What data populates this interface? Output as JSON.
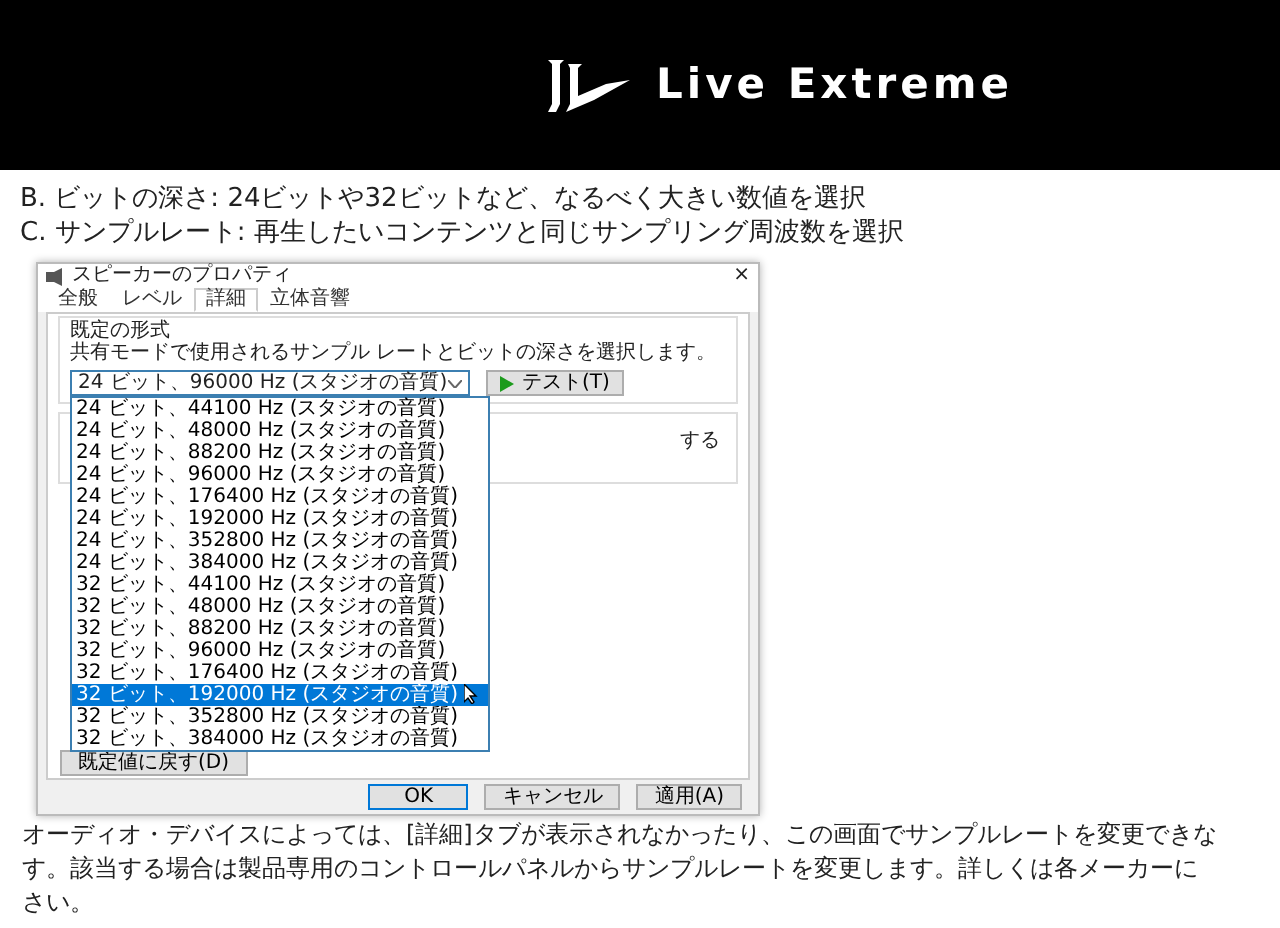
{
  "header": {
    "brand": "Live Extreme"
  },
  "intro_lines": [
    "B. ビットの深さ: 24ビットや32ビットなど、なるべく大きい数値を選択",
    "C. サンプルレート: 再生したいコンテンツと同じサンプリング周波数を選択"
  ],
  "dialog": {
    "title": "スピーカーのプロパティ",
    "close": "×",
    "tabs": [
      {
        "label": "全般",
        "selected": false
      },
      {
        "label": "レベル",
        "selected": false
      },
      {
        "label": "詳細",
        "selected": true
      },
      {
        "label": "立体音響",
        "selected": false
      }
    ],
    "group_label": "既定の形式",
    "description": "共有モードで使用されるサンプル レートとビットの深さを選択します。",
    "dropdown_value": "24 ビット、96000 Hz (スタジオの音質)",
    "test_button": "テスト(T)",
    "options": [
      {
        "label": "24 ビット、44100 Hz (スタジオの音質)",
        "selected": false
      },
      {
        "label": "24 ビット、48000 Hz (スタジオの音質)",
        "selected": false
      },
      {
        "label": "24 ビット、88200 Hz (スタジオの音質)",
        "selected": false
      },
      {
        "label": "24 ビット、96000 Hz (スタジオの音質)",
        "selected": false
      },
      {
        "label": "24 ビット、176400 Hz (スタジオの音質)",
        "selected": false
      },
      {
        "label": "24 ビット、192000 Hz (スタジオの音質)",
        "selected": false
      },
      {
        "label": "24 ビット、352800 Hz (スタジオの音質)",
        "selected": false
      },
      {
        "label": "24 ビット、384000 Hz (スタジオの音質)",
        "selected": false
      },
      {
        "label": "32 ビット、44100 Hz (スタジオの音質)",
        "selected": false
      },
      {
        "label": "32 ビット、48000 Hz (スタジオの音質)",
        "selected": false
      },
      {
        "label": "32 ビット、88200 Hz (スタジオの音質)",
        "selected": false
      },
      {
        "label": "32 ビット、96000 Hz (スタジオの音質)",
        "selected": false
      },
      {
        "label": "32 ビット、176400 Hz (スタジオの音質)",
        "selected": false
      },
      {
        "label": "32 ビット、192000 Hz (スタジオの音質)",
        "selected": true
      },
      {
        "label": "32 ビット、352800 Hz (スタジオの音質)",
        "selected": false
      },
      {
        "label": "32 ビット、384000 Hz (スタジオの音質)",
        "selected": false
      }
    ],
    "hidden_group_text": "する",
    "reset_button": "既定値に戻す(D)",
    "buttons": [
      {
        "label": "OK",
        "kind": "default"
      },
      {
        "label": "キャンセル",
        "kind": "normal"
      },
      {
        "label": "適用(A)",
        "kind": "normal"
      }
    ]
  },
  "paragraph_lines": [
    "オーディオ・デバイスによっては、[詳細]タブが表示されなかったり、この画面でサンプルレートを変更できな",
    "す。該当する場合は製品専用のコントロールパネルからサンプルレートを変更します。詳しくは各メーカーに",
    "さい。"
  ]
}
